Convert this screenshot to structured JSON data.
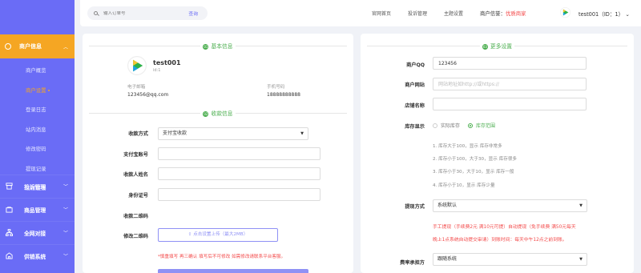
{
  "sidebar": {
    "active_menu": "商户信息",
    "sub_items": [
      "商户概览",
      "商户设置",
      "登录日志",
      "站内消息",
      "修改密码",
      "提现记录",
      "店铺链接"
    ],
    "active_index": 1,
    "groups": [
      {
        "label": "投诉管理",
        "icon": "shop-icon"
      },
      {
        "label": "商品管理",
        "icon": "bag-icon"
      },
      {
        "label": "全网对接",
        "icon": "network-icon"
      },
      {
        "label": "供销系统",
        "icon": "supply-icon"
      }
    ]
  },
  "topbar": {
    "search_placeholder": "输入订单号",
    "search_button": "查询",
    "nav": [
      "官网首页",
      "投诉管理",
      "主题设置"
    ],
    "merchant_label": "商户信誉：",
    "merchant_level": "优质商家",
    "user": "test001（ID：1）",
    "user_chevron": "⌄"
  },
  "basic": {
    "section_num": "01",
    "section_title": "基本信息",
    "name": "test001",
    "id": "id:1",
    "email_label": "电子邮箱",
    "email": "123456@qq.com",
    "phone_label": "手机号码",
    "phone": "18888888888"
  },
  "payment": {
    "section_num": "02",
    "section_title": "收款信息",
    "method_label": "收款方式",
    "method_value": "支付宝收款",
    "alipay_label": "支付宝账号",
    "payee_label": "收款人姓名",
    "idcard_label": "身份证号",
    "qrcode_label": "收款二维码",
    "edit_qrcode_label": "修改二维码",
    "upload_text": "点击设置上传（最大2MB）",
    "warning": "*慎重填写 再三确认 填写后不可修改 如需修改请联系平台客服。"
  },
  "more": {
    "section_num": "03",
    "section_title": "更多设置",
    "qq_label": "商户QQ",
    "qq_value": "123456",
    "site_label": "商户网站",
    "site_placeholder": "网站地址如http://或https://",
    "shop_label": "店铺名称",
    "stock_label": "库存显示",
    "stock_opt1": "实际库存",
    "stock_opt2": "库存范围",
    "rules": [
      "1. 库存大于100，显示 库存非常多",
      "2. 库存小于100，大于30，显示 库存很多",
      "3. 库存小于30，大于10，显示 库存一般",
      "4. 库存小于10，显示 库存少量"
    ],
    "withdraw_label": "提现方式",
    "withdraw_value": "系统默认",
    "notice_line1": "手工提现（手续费2元 满10元可提）自动提现（免手续费 满50元每天",
    "notice_line2": "晚上1点系统自动提交审请）到账时间：每天中午12点之前到账。",
    "fee_label": "费率承担方",
    "fee_value": "跟随系统"
  },
  "colors": {
    "sidebar": "#6a6cf6",
    "active": "#f5a623",
    "accent_green": "#4bae4f",
    "warning": "#f34a4a"
  }
}
